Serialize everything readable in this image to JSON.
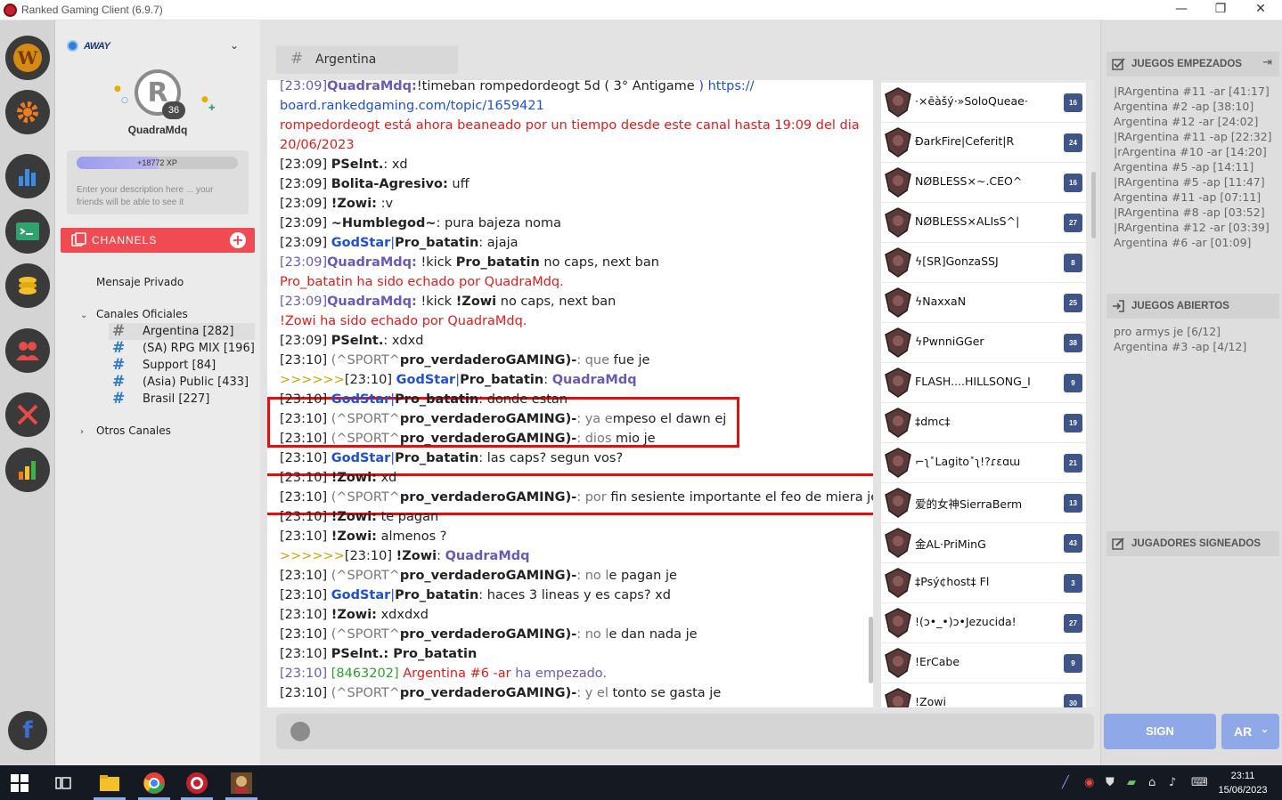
{
  "window": {
    "title": "Ranked Gaming Client (6.9.7)",
    "minimize": "—",
    "restore": "❐",
    "close": "✕"
  },
  "profile": {
    "status": "AWAY",
    "avatar_letter": "R",
    "level": "36",
    "username": "QuadraMdq",
    "xp": "+18772 XP",
    "xp_fill_fraction": 0.5,
    "description_placeholder": "Enter your description here ... your friends will be able to see it"
  },
  "channels": {
    "header": "CHANNELS",
    "private": "Mensaje Privado",
    "official_group": "Canales Oficiales",
    "official": [
      {
        "name": "Argentina [282]",
        "active": true
      },
      {
        "name": "(SA) RPG MIX [196]",
        "active": false
      },
      {
        "name": "Support [84]",
        "active": false
      },
      {
        "name": "(Asia) Public [433]",
        "active": false
      },
      {
        "name": "Brasil [227]",
        "active": false
      }
    ],
    "other_group": "Otros Canales"
  },
  "chat": {
    "channel_name": "Argentina",
    "lines": [
      "[23:09] QuadraMdq: !timeban rompedordeogt 5d ( 3° Antigamer ) https://",
      "board.rankedgaming.com/topic/1659421",
      "rompedordeogt está ahora beaneado por un tiempo desde este canal hasta 19:09 del dia",
      "20/06/2023",
      "[23:09] PSelnt.: xd",
      "[23:09] Bolita-Agresivo: uff",
      "[23:09] !Zowi: :v",
      "[23:09] ~Humblegod~: pura bajeza noma",
      "[23:09] GodStar|Pro_batatin: ajaja",
      "[23:09] QuadraMdq: !kick Pro_batatin no caps, next ban",
      "Pro_batatin ha sido echado por QuadraMdq.",
      "[23:09] QuadraMdq: !kick !Zowi no caps, next ban",
      "!Zowi ha sido echado por QuadraMdq.",
      "[23:09] PSelnt.: xdxd",
      "[23:10] (^SPORT^pro_verdaderoGAMING)-: que fue je",
      ">>>>>>[23:10] GodStar|Pro_batatin: QuadraMdq",
      "[23:10] GodStar|Pro_batatin: donde estan",
      "[23:10] (^SPORT^pro_verdaderoGAMING)-: ya empeso el dawn ej",
      "[23:10] (^SPORT^pro_verdaderoGAMING)-: dios mio je",
      "[23:10] GodStar|Pro_batatin: las caps? segun vos?",
      "[23:10] !Zowi: xd",
      "[23:10] (^SPORT^pro_verdaderoGAMING)-: por fin sesiente importante el feo de miera je",
      "[23:10] !Zowi: te pagan",
      "[23:10] !Zowi: almenos ?",
      ">>>>>>[23:10] !Zowi: QuadraMdq",
      "[23:10] (^SPORT^pro_verdaderoGAMING)-: no le pagan je",
      "[23:10] GodStar|Pro_batatin: haces 3 lineas y es caps? xd",
      "[23:10] !Zowi: xdxdxd",
      "[23:10] (^SPORT^pro_verdaderoGAMING)-: no le dan nada je",
      "[23:10] PSelnt.: Pro_batatin",
      "[23:10] [8463202] Argentina #6 -ar ha empezado.",
      "[23:10] (^SPORT^pro_verdaderoGAMING)-: y el tonto se gasta je"
    ],
    "input_placeholder": ""
  },
  "users": [
    {
      "name": "·×ēàšý·»SoloQueae·",
      "count": "16"
    },
    {
      "name": "ÐarkFire|Ceferit|R",
      "count": "24"
    },
    {
      "name": "NØBLESS×~.CEO^",
      "count": "16"
    },
    {
      "name": "NØBLESS×ALIsS^|",
      "count": "27"
    },
    {
      "name": "ϟ[SR]GonzaSSJ",
      "count": "8"
    },
    {
      "name": "ϟNaxxaN",
      "count": "25"
    },
    {
      "name": "ϟPwnniGGer",
      "count": "38"
    },
    {
      "name": "FLASH....HILLSONG_I",
      "count": "9"
    },
    {
      "name": "‡dmc‡",
      "count": "19"
    },
    {
      "name": "⌐ʅ˟Lagito˟ʅ!?ɾɛɑɯ",
      "count": "21"
    },
    {
      "name": "爱的女神SierraBerm",
      "count": "13"
    },
    {
      "name": "金AL·PriMinG",
      "count": "43"
    },
    {
      "name": "‡Psý¢host‡ Fl",
      "count": "3"
    },
    {
      "name": "!(ↄ•_•)ↄ•Jezucida!",
      "count": "27"
    },
    {
      "name": "!ErCabe",
      "count": "9"
    },
    {
      "name": "!Zowi",
      "count": "30"
    }
  ],
  "right_panel": {
    "started_title": "JUEGOS EMPEZADOS",
    "started": [
      "|RArgentina #11 -ar [41:17]",
      "Argentina #2 -ap [38:10]",
      "Argentina #12 -ar [24:02]",
      "|RArgentina #11 -ap [22:32]",
      "|rArgentina #10 -ar [14:20]",
      "Argentina #5 -ap [14:11]",
      "|RArgentina #5 -ap [11:47]",
      "Argentina #11 -ap [07:11]",
      "|RArgentina #8 -ap [03:52]",
      "|RArgentina #12 -ar [03:39]",
      "Argentina #6 -ar [01:09]"
    ],
    "open_title": "JUEGOS ABIERTOS",
    "open": [
      "pro armys je [6/12]",
      "Argentina #3 -ap [4/12]"
    ],
    "signed_title": "JUGADORES SIGNEADOS",
    "sign_label": "SIGN",
    "lang_label": "AR"
  },
  "taskbar": {
    "time": "23:11",
    "date": "15/06/2023"
  },
  "colors": {
    "accent_red": "#f04a52",
    "sign_blue": "#8ea8e8",
    "badge": "#3f5488",
    "link_blue": "#1f4fd6"
  }
}
